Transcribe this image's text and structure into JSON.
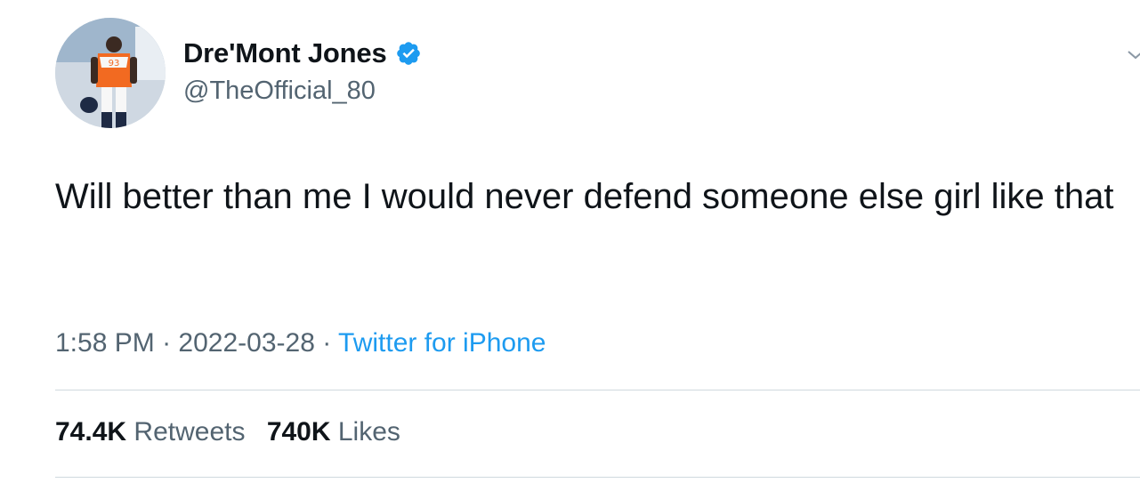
{
  "author": {
    "display_name": "Dre'Mont Jones",
    "handle": "@TheOfficial_80",
    "verified": true,
    "avatar_jersey": "93"
  },
  "tweet": {
    "text": "Will better than me I would never defend someone else girl like that",
    "time": "1:58 PM",
    "date": "2022-03-28",
    "separator": "·",
    "source": "Twitter for iPhone"
  },
  "stats": {
    "retweets_count": "74.4K",
    "retweets_label": "Retweets",
    "likes_count": "740K",
    "likes_label": "Likes"
  },
  "icons": {
    "verified": "verified-badge-icon",
    "more": "chevron-down-icon"
  },
  "colors": {
    "link": "#1d9bf0",
    "secondary_text": "#536471",
    "primary_text": "#0f1419"
  }
}
